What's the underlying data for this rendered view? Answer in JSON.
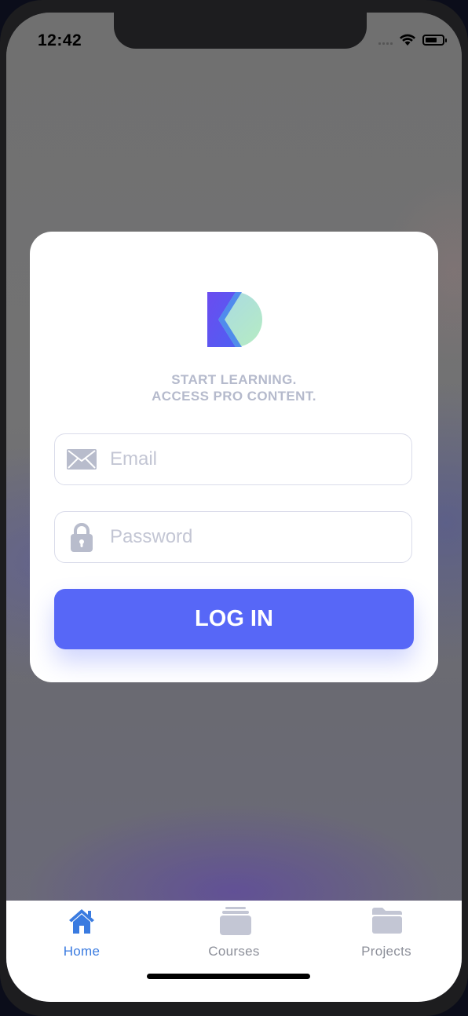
{
  "status_bar": {
    "time": "12:42"
  },
  "login": {
    "tagline_line1": "START LEARNING.",
    "tagline_line2": "ACCESS PRO CONTENT.",
    "email_placeholder": "Email",
    "password_placeholder": "Password",
    "login_button": "LOG IN"
  },
  "tabbar": {
    "tabs": [
      {
        "label": "Home",
        "icon": "home-icon",
        "active": true
      },
      {
        "label": "Courses",
        "icon": "courses-icon",
        "active": false
      },
      {
        "label": "Projects",
        "icon": "folder-icon",
        "active": false
      }
    ]
  },
  "colors": {
    "accent": "#5767F7",
    "active_tab": "#3A7BE0",
    "inactive_tab": "#8C8F99",
    "placeholder": "#C3C6D4",
    "tagline": "#B5BACC"
  }
}
